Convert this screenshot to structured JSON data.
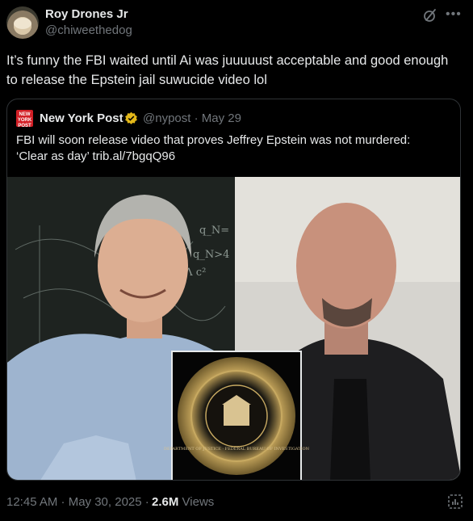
{
  "author": {
    "name": "Roy Drones Jr",
    "handle": "@chiweethedog"
  },
  "tweet": {
    "text": "It’s funny the FBI waited until Ai was juuuuust acceptable and good enough to release the Epstein jail suwucide video lol"
  },
  "quote": {
    "logo_text": "NEW YORK POST",
    "name": "New York Post",
    "handle_date": "@nypost · May 29",
    "text": "FBI will soon release video that proves Jeffrey Epstein was not murdered: ‘Clear as day’ trib.al/7bgqQ96",
    "image": {
      "board_text_1": "q_N=",
      "board_text_2": "q_N>4",
      "board_text_3": "√Λ c²",
      "seal_text": "DEPARTMENT OF JUSTICE · FEDERAL BUREAU OF INVESTIGATION"
    }
  },
  "footer": {
    "timestamp": "12:45 AM · May 30, 2025 ·",
    "views_count": "2.6M",
    "views_label": "Views"
  },
  "icons": {
    "grok": "grok-icon",
    "more": "more-icon",
    "verified": "verified-icon",
    "analytics": "analytics-icon"
  },
  "colors": {
    "background": "#000000",
    "text": "#e7e9ea",
    "muted": "#71767b",
    "border": "#2f3336",
    "verified_gold": "#e2b719",
    "nypost_red": "#d21f26"
  }
}
